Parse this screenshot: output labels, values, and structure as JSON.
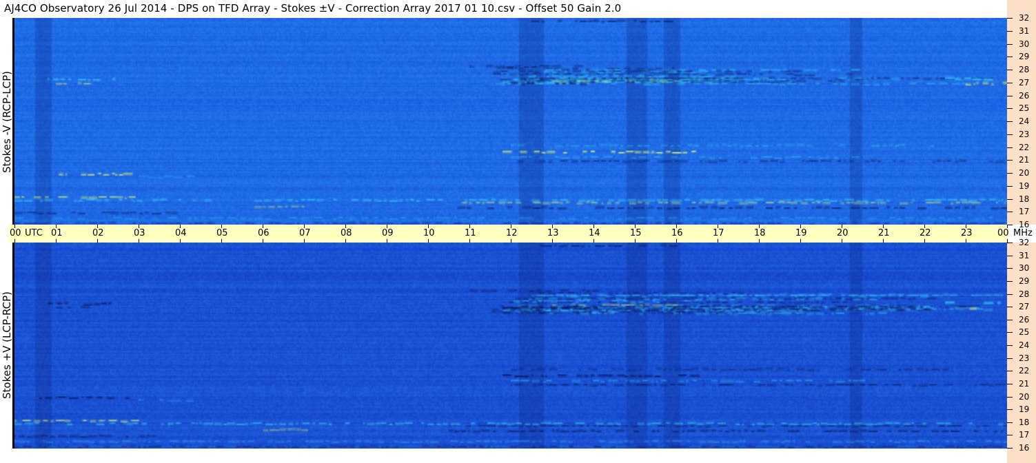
{
  "chart_data": {
    "type": "heatmap",
    "title": "AJ4CO Observatory  26 Jul 2014  -  DPS on TFD Array  -  Stokes ±V  -  Correction Array 2017 01 10.csv  -  Offset 50  Gain 2.0",
    "x_tick_labels": [
      "00",
      "01",
      "02",
      "03",
      "04",
      "05",
      "06",
      "07",
      "08",
      "09",
      "10",
      "11",
      "12",
      "13",
      "14",
      "15",
      "16",
      "17",
      "18",
      "19",
      "20",
      "21",
      "22",
      "23",
      "00"
    ],
    "x_unit_left": "UTC",
    "x_unit_right": "MHz",
    "xlim": [
      0,
      24
    ],
    "y_ticks": [
      32,
      31,
      30,
      29,
      28,
      27,
      26,
      25,
      24,
      23,
      22,
      21,
      20,
      19,
      18,
      17,
      16
    ],
    "ylim": [
      16,
      32
    ],
    "panels": [
      {
        "ylabel": "Stokes -V (RCP-LCP)"
      },
      {
        "ylabel": "Stokes +V (LCP-RCP)"
      }
    ],
    "colors": {
      "base_top": "#1e6ae6",
      "base_bottom": "#1a52d4",
      "bright": "#38d8ff",
      "hot": "#e8ff60",
      "dark": "#0a1050",
      "time_axis_bg": "#ffffc0",
      "freq_axis_bg": "#fde0c6"
    }
  }
}
